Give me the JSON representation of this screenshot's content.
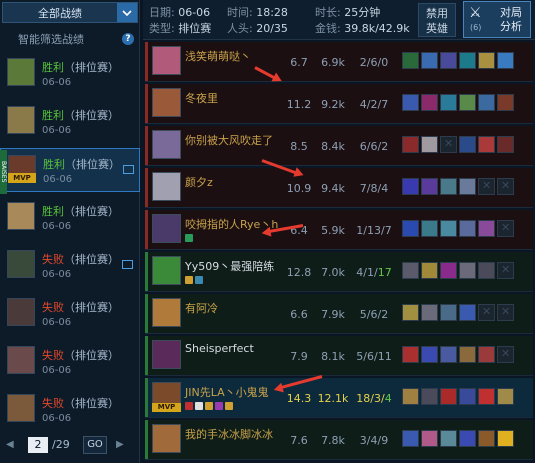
{
  "sidebar": {
    "filter_label": "全部战绩",
    "smart_filter_label": "智能筛选战绩",
    "help_icon": "?",
    "side_tag": "BAISES",
    "matches": [
      {
        "result": "胜利",
        "type": "（排位赛）",
        "date": "06-06",
        "win": true,
        "mvp": false,
        "video": false,
        "avatar": "#5b7a3a"
      },
      {
        "result": "胜利",
        "type": "（排位赛）",
        "date": "06-06",
        "win": true,
        "mvp": false,
        "video": false,
        "avatar": "#8a7a4a"
      },
      {
        "result": "胜利",
        "type": "（排位赛）",
        "date": "06-06",
        "win": true,
        "mvp": true,
        "video": true,
        "avatar": "#6a3a2a",
        "selected": true,
        "mvp_label": "MVP"
      },
      {
        "result": "胜利",
        "type": "（排位赛）",
        "date": "06-06",
        "win": true,
        "mvp": false,
        "video": false,
        "avatar": "#a88a5a"
      },
      {
        "result": "失败",
        "type": "（排位赛）",
        "date": "06-06",
        "win": false,
        "mvp": false,
        "video": true,
        "avatar": "#3a4a3a"
      },
      {
        "result": "失败",
        "type": "（排位赛）",
        "date": "06-06",
        "win": false,
        "mvp": false,
        "video": false,
        "avatar": "#4a3a3a"
      },
      {
        "result": "失败",
        "type": "（排位赛）",
        "date": "06-06",
        "win": false,
        "mvp": false,
        "video": false,
        "avatar": "#6a4a4a"
      },
      {
        "result": "失败",
        "type": "（排位赛）",
        "date": "06-06",
        "win": false,
        "mvp": false,
        "video": false,
        "avatar": "#7a5a3a"
      }
    ],
    "pager": {
      "current": "2",
      "total": "/29",
      "go_label": "GO"
    }
  },
  "header": {
    "date_key": "日期:",
    "date_val": "06-06",
    "time_key": "时间:",
    "time_val": "18:28",
    "duration_key": "时长:",
    "duration_val": "25分钟",
    "type_key": "类型:",
    "type_val": "排位赛",
    "players_key": "人头:",
    "players_val": "20/35",
    "gold_key": "金钱:",
    "gold_val": "39.8k/42.9k",
    "ban_label_1": "禁用",
    "ban_label_2": "英雄",
    "analysis_count": "(6)",
    "analysis_label_1": "对局",
    "analysis_label_2": "分析"
  },
  "players": [
    {
      "name": "浅笑萌萌哒丶",
      "team": "red",
      "score": "6.7",
      "gold": "6.9k",
      "kda": "2/6/0",
      "mvp": false,
      "me": false,
      "avatar": "#b25a7a",
      "items": [
        "#2a6a3a",
        "#3a6ab0",
        "#4a4a9a",
        "#1c7a8a",
        "#a89040",
        "#3a7ac0"
      ],
      "ticons": []
    },
    {
      "name": "冬夜里",
      "team": "red",
      "score": "11.2",
      "gold": "9.2k",
      "kda": "4/2/7",
      "mvp": false,
      "me": false,
      "avatar": "#9a5a3a",
      "items": [
        "#3a5ab0",
        "#8a2a6a",
        "#2a7a9a",
        "#5a8a4a",
        "#3a6aa0",
        "#7a3a2a"
      ],
      "ticons": []
    },
    {
      "name": "你别被大风吹走了",
      "team": "red",
      "score": "8.5",
      "gold": "8.4k",
      "kda": "6/6/2",
      "mvp": false,
      "me": false,
      "avatar": "#7a6a9a",
      "items": [
        "#8a2a2a",
        "#a09aa0",
        "empty",
        "#2a4a8a",
        "#aa3a3a",
        "#6a2a2a"
      ],
      "ticons": []
    },
    {
      "name": "颜夕z",
      "team": "red",
      "score": "10.9",
      "gold": "9.4k",
      "kda": "7/8/4",
      "mvp": false,
      "me": false,
      "avatar": "#a0a0b0",
      "items": [
        "#3a3ab0",
        "#5a3a9a",
        "#4a7a8a",
        "#6a7a9a",
        "empty",
        "empty"
      ],
      "ticons": []
    },
    {
      "name": "咬拇指的人Rye丶h",
      "team": "red",
      "score": "6.4",
      "gold": "5.9k",
      "kda": "1/13/7",
      "mvp": false,
      "me": false,
      "avatar": "#4a3a6a",
      "items": [
        "#2a4ab0",
        "#3a7a8a",
        "#4a8aa0",
        "#5a6a9a",
        "#8a4a9a",
        "empty"
      ],
      "ticons": [
        "#2a9a5a"
      ]
    },
    {
      "name": "Yy509丶最强陪练",
      "team": "blue",
      "score": "12.8",
      "gold": "7.0k",
      "kda": "4/1/17",
      "kda_green": true,
      "mvp": false,
      "me": false,
      "avatar": "#3a8a3a",
      "items": [
        "#5a5a6a",
        "#a08a3a",
        "#8a2a8a",
        "#6a6a7a",
        "#4a4a5a",
        "empty"
      ],
      "ticons": [
        "#d0a030",
        "#3a8ab0"
      ]
    },
    {
      "name": "有阿冷",
      "team": "blue",
      "score": "6.6",
      "gold": "7.9k",
      "kda": "5/6/2",
      "mvp": false,
      "me": false,
      "avatar": "#b07a3a",
      "items": [
        "#a09040",
        "#6a6a7a",
        "#4a6a8a",
        "#3a5ab0",
        "empty",
        "empty"
      ],
      "ticons": []
    },
    {
      "name": "Sheisperfect",
      "team": "blue",
      "score": "7.9",
      "gold": "8.1k",
      "kda": "5/6/11",
      "mvp": false,
      "me": false,
      "avatar": "#5a2a5a",
      "items": [
        "#aa3030",
        "#3a4ab0",
        "#4a5aa0",
        "#8a6a3a",
        "#9a3a3a",
        "empty"
      ],
      "ticons": []
    },
    {
      "name": "JIN先LA丶小鬼鬼",
      "team": "blue",
      "score": "14.3",
      "gold": "12.1k",
      "kda": "18/3/4",
      "kda_green": true,
      "mvp": true,
      "me": true,
      "mvp_label": "MVP",
      "avatar": "#7a4a2a",
      "items": [
        "#a08040",
        "#4a4a5a",
        "#aa2a2a",
        "#3a4a9a",
        "#c03030",
        "#a08a4a"
      ],
      "ticons": [
        "#c03030",
        "#e0e0e0",
        "#d0a030",
        "#9a3ab0",
        "#d0a030"
      ]
    },
    {
      "name": "我的手冰冰脚冰冰",
      "team": "blue",
      "score": "7.6",
      "gold": "7.8k",
      "kda": "3/4/9",
      "mvp": false,
      "me": false,
      "avatar": "#a06a3a",
      "items": [
        "#3a5ab0",
        "#b05a8a",
        "#5a8a9a",
        "#3a4ab0",
        "#8a5a2a",
        "#e0b020"
      ],
      "ticons": []
    }
  ]
}
